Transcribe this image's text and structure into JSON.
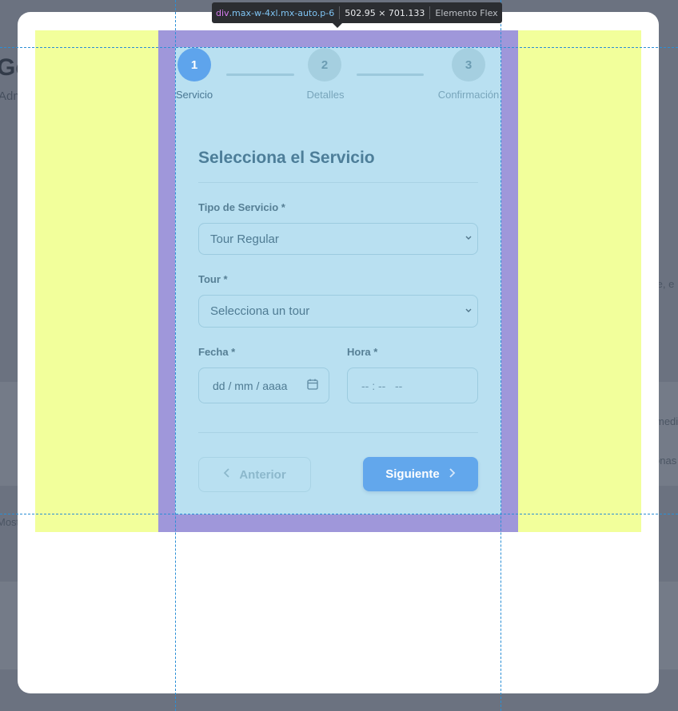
{
  "devtools": {
    "tag": "div",
    "classes": ".max-w-4xl.mx-auto.p-6",
    "size": "502.95 × 701.133",
    "badge": "Elemento Flex"
  },
  "background": {
    "title": "Ge",
    "subtitle": "Adm",
    "right_edge_1": "medi",
    "right_edge_2": "onas",
    "right_edge_3": "te, e",
    "left_edge_1": "Most"
  },
  "stepper": {
    "steps": [
      {
        "number": "1",
        "label": "Servicio",
        "state": "active"
      },
      {
        "number": "2",
        "label": "Detalles",
        "state": "inactive"
      },
      {
        "number": "3",
        "label": "Confirmación",
        "state": "inactive"
      }
    ]
  },
  "form": {
    "heading": "Selecciona el Servicio",
    "service_type": {
      "label": "Tipo de Servicio *",
      "value": "Tour Regular"
    },
    "tour": {
      "label": "Tour *",
      "value": "Selecciona un tour"
    },
    "date": {
      "label": "Fecha *",
      "placeholder": "dd / mm / aaaa"
    },
    "time": {
      "label": "Hora *",
      "placeholder": "-- : --   --"
    }
  },
  "actions": {
    "prev_label": "Anterior",
    "next_label": "Siguiente"
  },
  "colors": {
    "primary": "#62a7ec",
    "overlay_padding": "#eeff7a",
    "overlay_margin": "#968ce1",
    "overlay_content": "#b9e0f1"
  }
}
